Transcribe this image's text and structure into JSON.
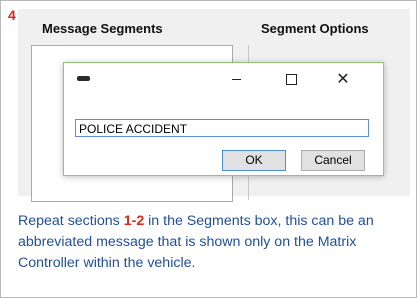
{
  "step_number": "4",
  "window": {
    "segments_header": "Message Segments",
    "options_header": "Segment Options"
  },
  "dialog": {
    "input_value": "POLICE ACCIDENT",
    "ok_label": "OK",
    "cancel_label": "Cancel",
    "close_glyph": "✕",
    "input_border_color": "#5b8fd9",
    "dialog_border_color": "#93c47d"
  },
  "caption": {
    "part1": "Repeat sections ",
    "highlight_1": "1",
    "dash": "-",
    "highlight_2": "2",
    "part2": " in the Segments box, this can be an abbreviated message that is shown only on the Matrix Controller within the vehicle.",
    "text_color": "#1f4f9e",
    "highlight_color": "#e4241b"
  }
}
